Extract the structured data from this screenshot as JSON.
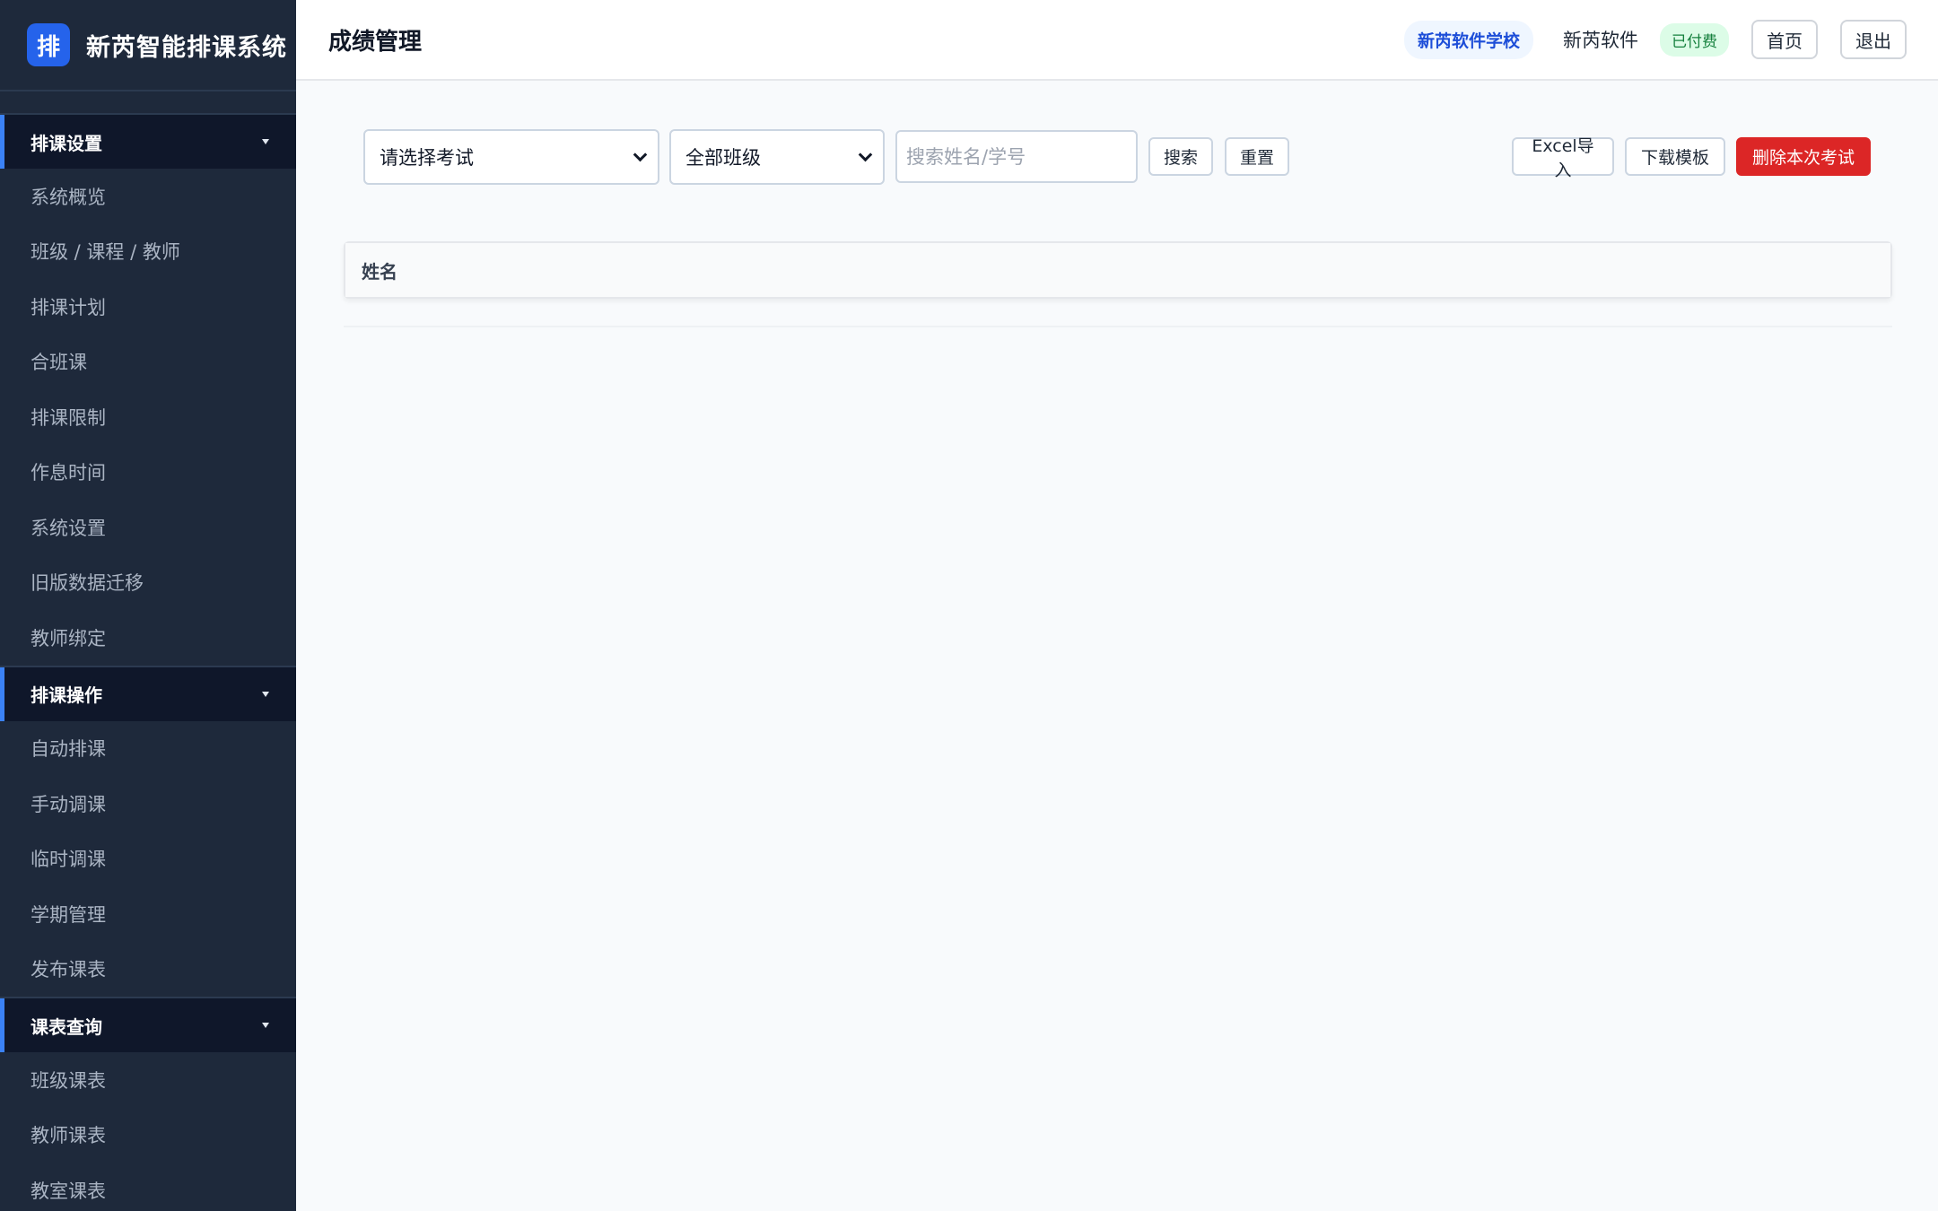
{
  "brand": {
    "logo_char": "排",
    "name": "新芮智能排课系统"
  },
  "sidebar": {
    "sections": [
      {
        "title": "排课设置",
        "items": [
          "系统概览",
          "班级 / 课程 / 教师",
          "排课计划",
          "合班课",
          "排课限制",
          "作息时间",
          "系统设置",
          "旧版数据迁移",
          "教师绑定"
        ]
      },
      {
        "title": "排课操作",
        "items": [
          "自动排课",
          "手动调课",
          "临时调课",
          "学期管理",
          "发布课表"
        ]
      },
      {
        "title": "课表查询",
        "items": [
          "班级课表",
          "教师课表",
          "教室课表"
        ]
      }
    ]
  },
  "header": {
    "title": "成绩管理",
    "school": "新芮软件学校",
    "user": "新芮软件",
    "badge": "已付费",
    "home_label": "首页",
    "logout_label": "退出"
  },
  "toolbar": {
    "exam_select": "请选择考试",
    "class_select": "全部班级",
    "search_placeholder": "搜索姓名/学号",
    "search_label": "搜索",
    "reset_label": "重置",
    "import_label": "Excel导入",
    "template_label": "下载模板",
    "delete_label": "删除本次考试"
  },
  "table": {
    "columns": [
      "姓名"
    ]
  },
  "colors": {
    "sidebar_bg": "#1e293b",
    "accent": "#2563eb",
    "danger": "#dc2626",
    "success": "#15803d"
  }
}
